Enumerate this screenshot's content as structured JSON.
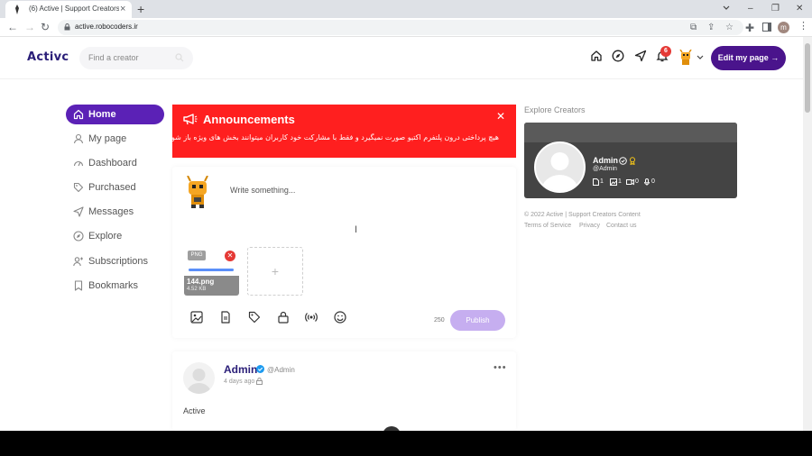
{
  "browser": {
    "tab_title": "(6) Active | Support Creators Con",
    "url": "active.robocoders.ir",
    "profile_initial": "m"
  },
  "header": {
    "logo": "Activc",
    "search_placeholder": "Find a creator",
    "notification_count": "6",
    "edit_button": "Edit my page →"
  },
  "nav": {
    "items": [
      {
        "label": "Home",
        "icon": "home-icon",
        "active": true
      },
      {
        "label": "My page",
        "icon": "user-icon"
      },
      {
        "label": "Dashboard",
        "icon": "dashboard-icon"
      },
      {
        "label": "Purchased",
        "icon": "tag-icon"
      },
      {
        "label": "Messages",
        "icon": "send-icon"
      },
      {
        "label": "Explore",
        "icon": "compass-icon"
      },
      {
        "label": "Subscriptions",
        "icon": "users-icon"
      },
      {
        "label": "Bookmarks",
        "icon": "bookmark-icon"
      }
    ]
  },
  "announcement": {
    "title": "Announcements",
    "message": "هیچ پرداختی درون پلتفرم اکتیو صورت نمیگیرد و فقط با مشارکت خود کاربران میتوانند بخش های ویژه باز شود."
  },
  "compose": {
    "placeholder": "Write something...",
    "file_tag": "PNG",
    "file_name": "144.png",
    "file_size": "4.52 KB",
    "upload_progress": 1.0,
    "char_count": "250",
    "publish_label": "Publish",
    "add_media": "+"
  },
  "post": {
    "author": "Admin",
    "handle": "@Admin",
    "time": "4 days ago",
    "body": "Active",
    "menu": "•••"
  },
  "sidebar": {
    "explore_title": "Explore Creators",
    "creator": {
      "name": "Admin",
      "handle": "@Admin",
      "stats": {
        "posts": "1",
        "images": "1",
        "videos": "0",
        "audio": "0"
      }
    },
    "copyright": "© 2022 Active | Support Creators Content",
    "links": [
      "Terms of Service",
      "Privacy",
      "Contact us"
    ]
  },
  "colors": {
    "brand": "#4a148c",
    "nav_active": "#5b21b6",
    "announcement_bg": "#ff1f1f",
    "publish_bg": "#c6aef0",
    "creator_card_bg": "#444444"
  }
}
